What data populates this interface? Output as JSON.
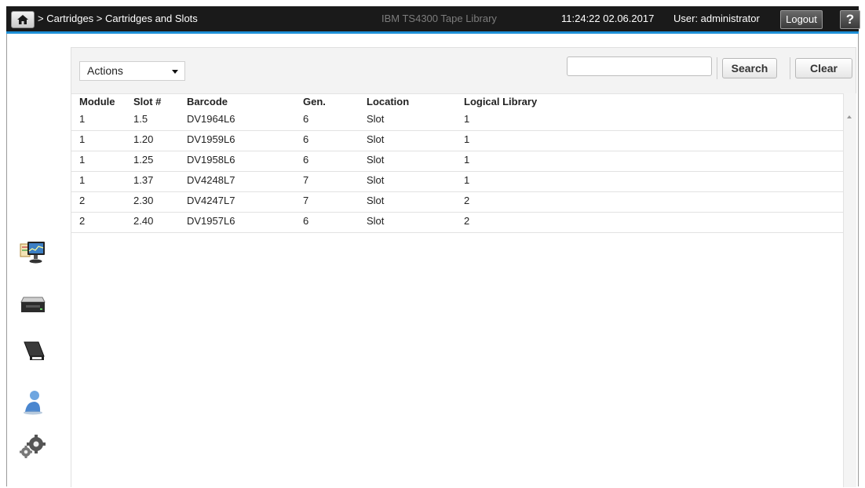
{
  "header": {
    "breadcrumb": [
      {
        "label": "> Cartridges"
      },
      {
        "label": "> Cartridges and Slots"
      }
    ],
    "app_title": "IBM TS4300 Tape Library",
    "datetime": "11:24:22  02.06.2017",
    "user": "User: administrator",
    "logout_label": "Logout",
    "help_label": "?",
    "accent_color": "#1e8fd6"
  },
  "sidebar": {
    "icons": [
      "monitoring-icon",
      "tape-drive-icon",
      "cartridge-icon",
      "user-icon",
      "settings-gears-icon"
    ]
  },
  "toolbar": {
    "actions_label": "Actions",
    "search_value": "",
    "search_button": "Search",
    "clear_button": "Clear"
  },
  "table": {
    "columns": [
      "Module",
      "Slot #",
      "Barcode",
      "Gen.",
      "Location",
      "Logical Library"
    ],
    "rows": [
      [
        "1",
        "1.5",
        "DV1964L6",
        "6",
        "Slot",
        "1"
      ],
      [
        "1",
        "1.20",
        "DV1959L6",
        "6",
        "Slot",
        "1"
      ],
      [
        "1",
        "1.25",
        "DV1958L6",
        "6",
        "Slot",
        "1"
      ],
      [
        "1",
        "1.37",
        "DV4248L7",
        "7",
        "Slot",
        "1"
      ],
      [
        "2",
        "2.30",
        "DV4247L7",
        "7",
        "Slot",
        "2"
      ],
      [
        "2",
        "2.40",
        "DV1957L6",
        "6",
        "Slot",
        "2"
      ]
    ]
  }
}
